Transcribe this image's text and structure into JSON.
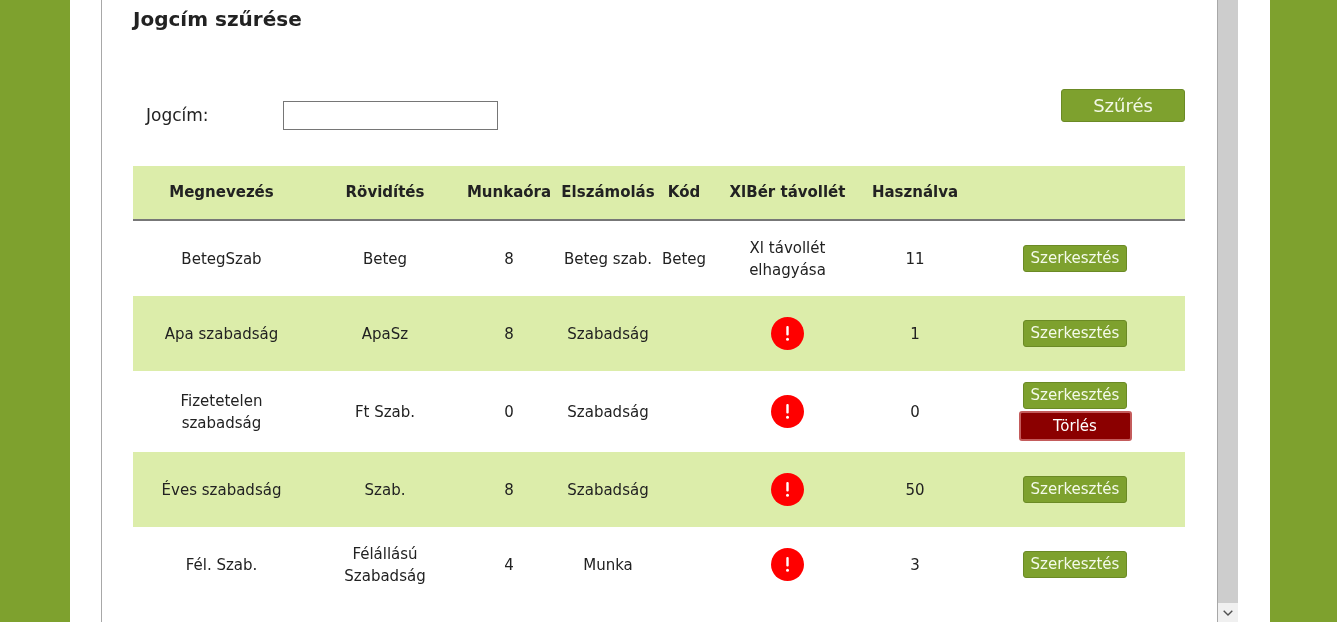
{
  "title": "Jogcím szűrése",
  "filter": {
    "label": "Jogcím:",
    "button": "Szűrés"
  },
  "table": {
    "columns": [
      "Megnevezés",
      "Rövidítés",
      "Munkaóra",
      "Elszámolás",
      "Kód",
      "XlBér távollét",
      "Használva"
    ],
    "rows": [
      {
        "name": "BetegSzab",
        "abbreviation": "Beteg",
        "hours": "8",
        "accounting": "Beteg szab.",
        "code": "Beteg",
        "xlber": {
          "kind": "text",
          "text": "Xl távollét elhagyása"
        },
        "used": "11",
        "actions": [
          {
            "kind": "edit",
            "label": "Szerkesztés"
          }
        ]
      },
      {
        "name": "Apa szabadság",
        "abbreviation": "ApaSz",
        "hours": "8",
        "accounting": "Szabadság",
        "xlber": {
          "kind": "warning"
        },
        "used": "1",
        "actions": [
          {
            "kind": "edit",
            "label": "Szerkesztés"
          }
        ]
      },
      {
        "name": "Fizetetelen szabadság",
        "abbreviation": "Ft Szab.",
        "hours": "0",
        "accounting": "Szabadság",
        "xlber": {
          "kind": "warning"
        },
        "used": "0",
        "actions": [
          {
            "kind": "edit",
            "label": "Szerkesztés"
          },
          {
            "kind": "delete",
            "label": "Törlés"
          }
        ]
      },
      {
        "name": "Éves szabadság",
        "abbreviation": "Szab.",
        "hours": "8",
        "accounting": "Szabadság",
        "xlber": {
          "kind": "warning"
        },
        "used": "50",
        "actions": [
          {
            "kind": "edit",
            "label": "Szerkesztés"
          }
        ]
      },
      {
        "name": "Fél. Szab.",
        "abbreviation": "Félállású Szabadság",
        "hours": "4",
        "accounting": "Munka",
        "xlber": {
          "kind": "warning"
        },
        "used": "3",
        "actions": [
          {
            "kind": "edit",
            "label": "Szerkesztés"
          }
        ]
      }
    ]
  }
}
